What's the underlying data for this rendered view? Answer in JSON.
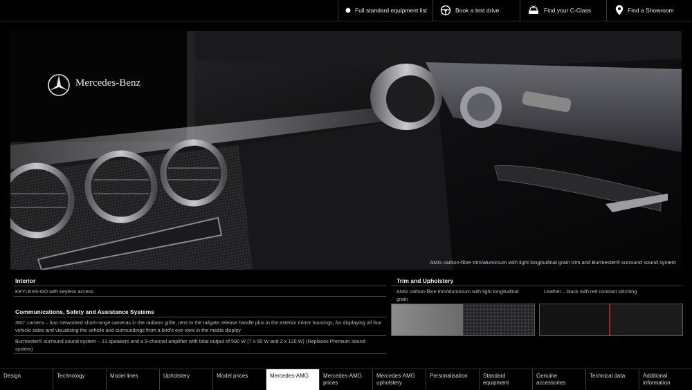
{
  "topbar": {
    "items": [
      {
        "label": "Full standard equipment list",
        "icon": "dot-icon"
      },
      {
        "label": "Book a test drive",
        "icon": "steering-wheel-icon"
      },
      {
        "label": "Find your C-Class",
        "icon": "car-icon"
      },
      {
        "label": "Find a Showroom",
        "icon": "map-pin-icon"
      }
    ]
  },
  "hero": {
    "brand": "Mercedes-Benz",
    "caption": "AMG carbon-fibre trim/aluminium with light longitudinal grain trim and Burmester® surround sound system"
  },
  "interior": {
    "title": "Interior",
    "items": [
      "KEYLESS-GO with keyless access"
    ]
  },
  "communications": {
    "title": "Communications, Safety and Assistance Systems",
    "items": [
      "360° camera – four networked short-range cameras in the radiator grille, next to the tailgate release handle plus in the exterior mirror housings, for displaying all four vehicle sides and visualising the vehicle and surroundings from a bird's eye view in the media display",
      "Burmester® surround sound system – 13 speakers and a 9-channel amplifier with total output of 590 W (7 x 50 W and 2 x 120 W) (Replaces Premium sound system)"
    ]
  },
  "trim": {
    "title": "Trim and Upholstery",
    "options": [
      {
        "label": "AMG carbon-fibre trim/aluminium with light longitudinal grain"
      },
      {
        "label": "Leather – black with red contrast stitching"
      }
    ]
  },
  "bottomnav": {
    "items": [
      {
        "label": "Design"
      },
      {
        "label": "Technology"
      },
      {
        "label": "Model lines"
      },
      {
        "label": "Upholstery"
      },
      {
        "label": "Model prices"
      },
      {
        "label": "Mercedes-AMG"
      },
      {
        "label": "Mercedes-AMG prices"
      },
      {
        "label": "Mercedes-AMG upholstery"
      },
      {
        "label": "Personalisation"
      },
      {
        "label": "Standard equipment"
      },
      {
        "label": "Genuine accessories"
      },
      {
        "label": "Technical data"
      },
      {
        "label": "Additional information"
      }
    ],
    "active_index": 5
  }
}
